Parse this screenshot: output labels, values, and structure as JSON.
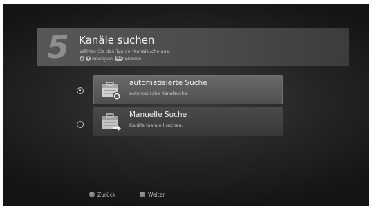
{
  "header": {
    "step_number": "5",
    "title": "Kanäle suchen",
    "subtitle": "Wählen Sie den Typ der Kanalsuche aus.",
    "hint_up": "▲",
    "hint_down": "▼",
    "hint_move": "Bewegen",
    "hint_ok_key": "OK",
    "hint_select": "Wählen"
  },
  "options": [
    {
      "title": "automatisierte Suche",
      "description": "automatische Kanalsuche.",
      "selected": true,
      "icon": "auto-search-icon"
    },
    {
      "title": "Manuelle Suche",
      "description": "Kanäle manuell suchen.",
      "selected": false,
      "icon": "manual-search-icon"
    }
  ],
  "footer": {
    "back_label": "Zurück",
    "next_label": "Weiter"
  },
  "colors": {
    "background": "#242424",
    "banner": "#575757",
    "text": "#f0f0f0",
    "muted_text": "#bdbdbd"
  }
}
